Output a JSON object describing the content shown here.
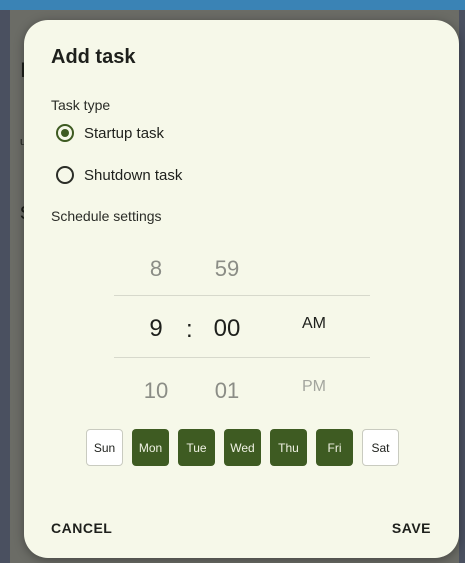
{
  "background": {
    "fragments": [
      "n",
      "up",
      "sl"
    ]
  },
  "dialog": {
    "title": "Add task",
    "task_type_label": "Task type",
    "task_types": [
      {
        "label": "Startup task",
        "selected": true
      },
      {
        "label": "Shutdown task",
        "selected": false
      }
    ],
    "schedule_label": "Schedule settings",
    "time_picker": {
      "hour": {
        "prev": "8",
        "current": "9",
        "next": "10"
      },
      "separator": ":",
      "minute": {
        "prev": "59",
        "current": "00",
        "next": "01"
      },
      "ampm": {
        "prev": "",
        "current": "AM",
        "next": "PM"
      }
    },
    "days": [
      {
        "label": "Sun",
        "selected": false
      },
      {
        "label": "Mon",
        "selected": true
      },
      {
        "label": "Tue",
        "selected": true
      },
      {
        "label": "Wed",
        "selected": true
      },
      {
        "label": "Thu",
        "selected": true
      },
      {
        "label": "Fri",
        "selected": true
      },
      {
        "label": "Sat",
        "selected": false
      }
    ],
    "cancel_label": "CANCEL",
    "save_label": "SAVE"
  },
  "colors": {
    "accent": "#3e5b22",
    "dialog_bg": "#f6f8e9"
  }
}
